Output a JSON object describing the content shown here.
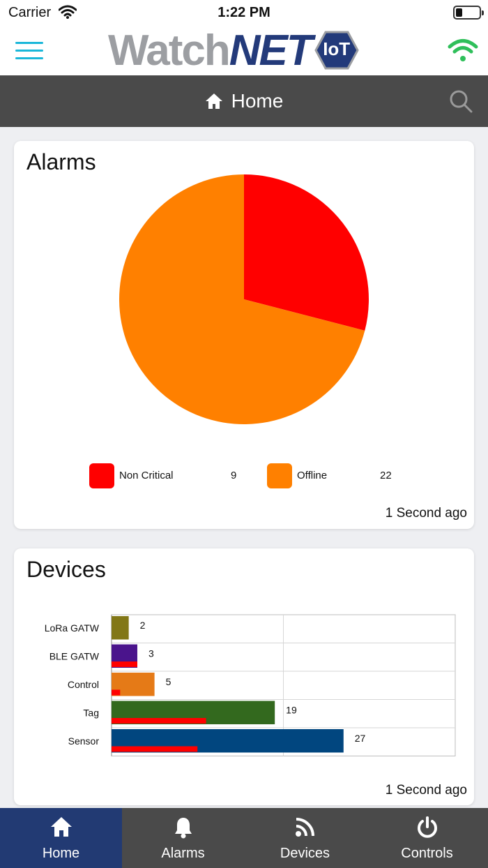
{
  "status_bar": {
    "carrier": "Carrier",
    "time": "1:22 PM"
  },
  "header": {
    "logo": {
      "part1": "Watch",
      "part2": "NET",
      "badge": "IoT"
    }
  },
  "title_bar": {
    "title": "Home"
  },
  "alarms": {
    "title": "Alarms",
    "updated": "1 Second ago",
    "legend": [
      {
        "label": "Non Critical",
        "value": "9",
        "color": "#ff0000"
      },
      {
        "label": "Offline",
        "value": "22",
        "color": "#ff8000"
      }
    ]
  },
  "devices": {
    "title": "Devices",
    "updated": "1 Second ago"
  },
  "chart_data": [
    {
      "type": "pie",
      "title": "Alarms",
      "categories": [
        "Non Critical",
        "Offline"
      ],
      "values": [
        9,
        22
      ],
      "colors": [
        "#ff0000",
        "#ff8000"
      ],
      "legend": "bottom"
    },
    {
      "type": "bar",
      "orientation": "horizontal",
      "title": "Devices",
      "categories": [
        "LoRa GATW",
        "BLE GATW",
        "Control",
        "Tag",
        "Sensor"
      ],
      "values": [
        2,
        3,
        5,
        19,
        27
      ],
      "colors": [
        "#827717",
        "#4a148c",
        "#e57a17",
        "#33691e",
        "#01467f"
      ],
      "overlay_color": "#ff0000",
      "overlay_values": [
        0,
        3,
        1,
        11,
        10
      ],
      "xlim": [
        0,
        40
      ],
      "grid": true
    }
  ],
  "bottom_nav": [
    {
      "label": "Home",
      "icon": "home-icon",
      "active": true
    },
    {
      "label": "Alarms",
      "icon": "bell-icon",
      "active": false
    },
    {
      "label": "Devices",
      "icon": "rss-icon",
      "active": false
    },
    {
      "label": "Controls",
      "icon": "power-icon",
      "active": false
    }
  ]
}
